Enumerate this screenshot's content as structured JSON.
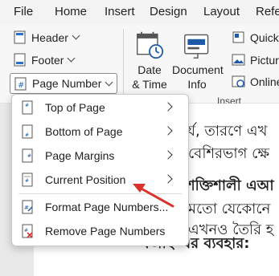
{
  "menubar": {
    "tabs": [
      "File",
      "Home",
      "Insert",
      "Design",
      "Layout",
      "Refe"
    ]
  },
  "ribbon": {
    "header_label": "Header",
    "footer_label": "Footer",
    "page_number_label": "Page Number",
    "date_time_line1": "Date",
    "date_time_line2": "& Time",
    "document_info_line1": "Document",
    "document_info_line2": "Info",
    "quick_parts_label": "Quick",
    "pictures_label": "Picture",
    "online_label": "Online",
    "insert_group_label": "Insert"
  },
  "dropdown": {
    "items": [
      {
        "label": "Top of Page",
        "has_submenu": true,
        "icon": "page-top-icon"
      },
      {
        "label": "Bottom of Page",
        "has_submenu": true,
        "icon": "page-bottom-icon"
      },
      {
        "label": "Page Margins",
        "has_submenu": true,
        "icon": "page-margins-icon"
      },
      {
        "label": "Current Position",
        "has_submenu": true,
        "icon": "current-position-icon"
      },
      {
        "label": "Format Page Numbers...",
        "has_submenu": false,
        "icon": "format-page-numbers-icon"
      },
      {
        "label": "Remove Page Numbers",
        "has_submenu": false,
        "icon": "remove-page-numbers-icon"
      }
    ]
  },
  "document": {
    "lines": [
      "কর্য, তারণে এখ",
      "বেশিরভাগ ক্ষে",
      "শক্তিশালী এআ",
      "মতো যেকোনে",
      "এখনও তৈরি হ",
      "এআই-এর ব্যবহার:"
    ]
  },
  "colors": {
    "accent_blue": "#1e5aa8",
    "annotation_red": "#d9322b"
  }
}
